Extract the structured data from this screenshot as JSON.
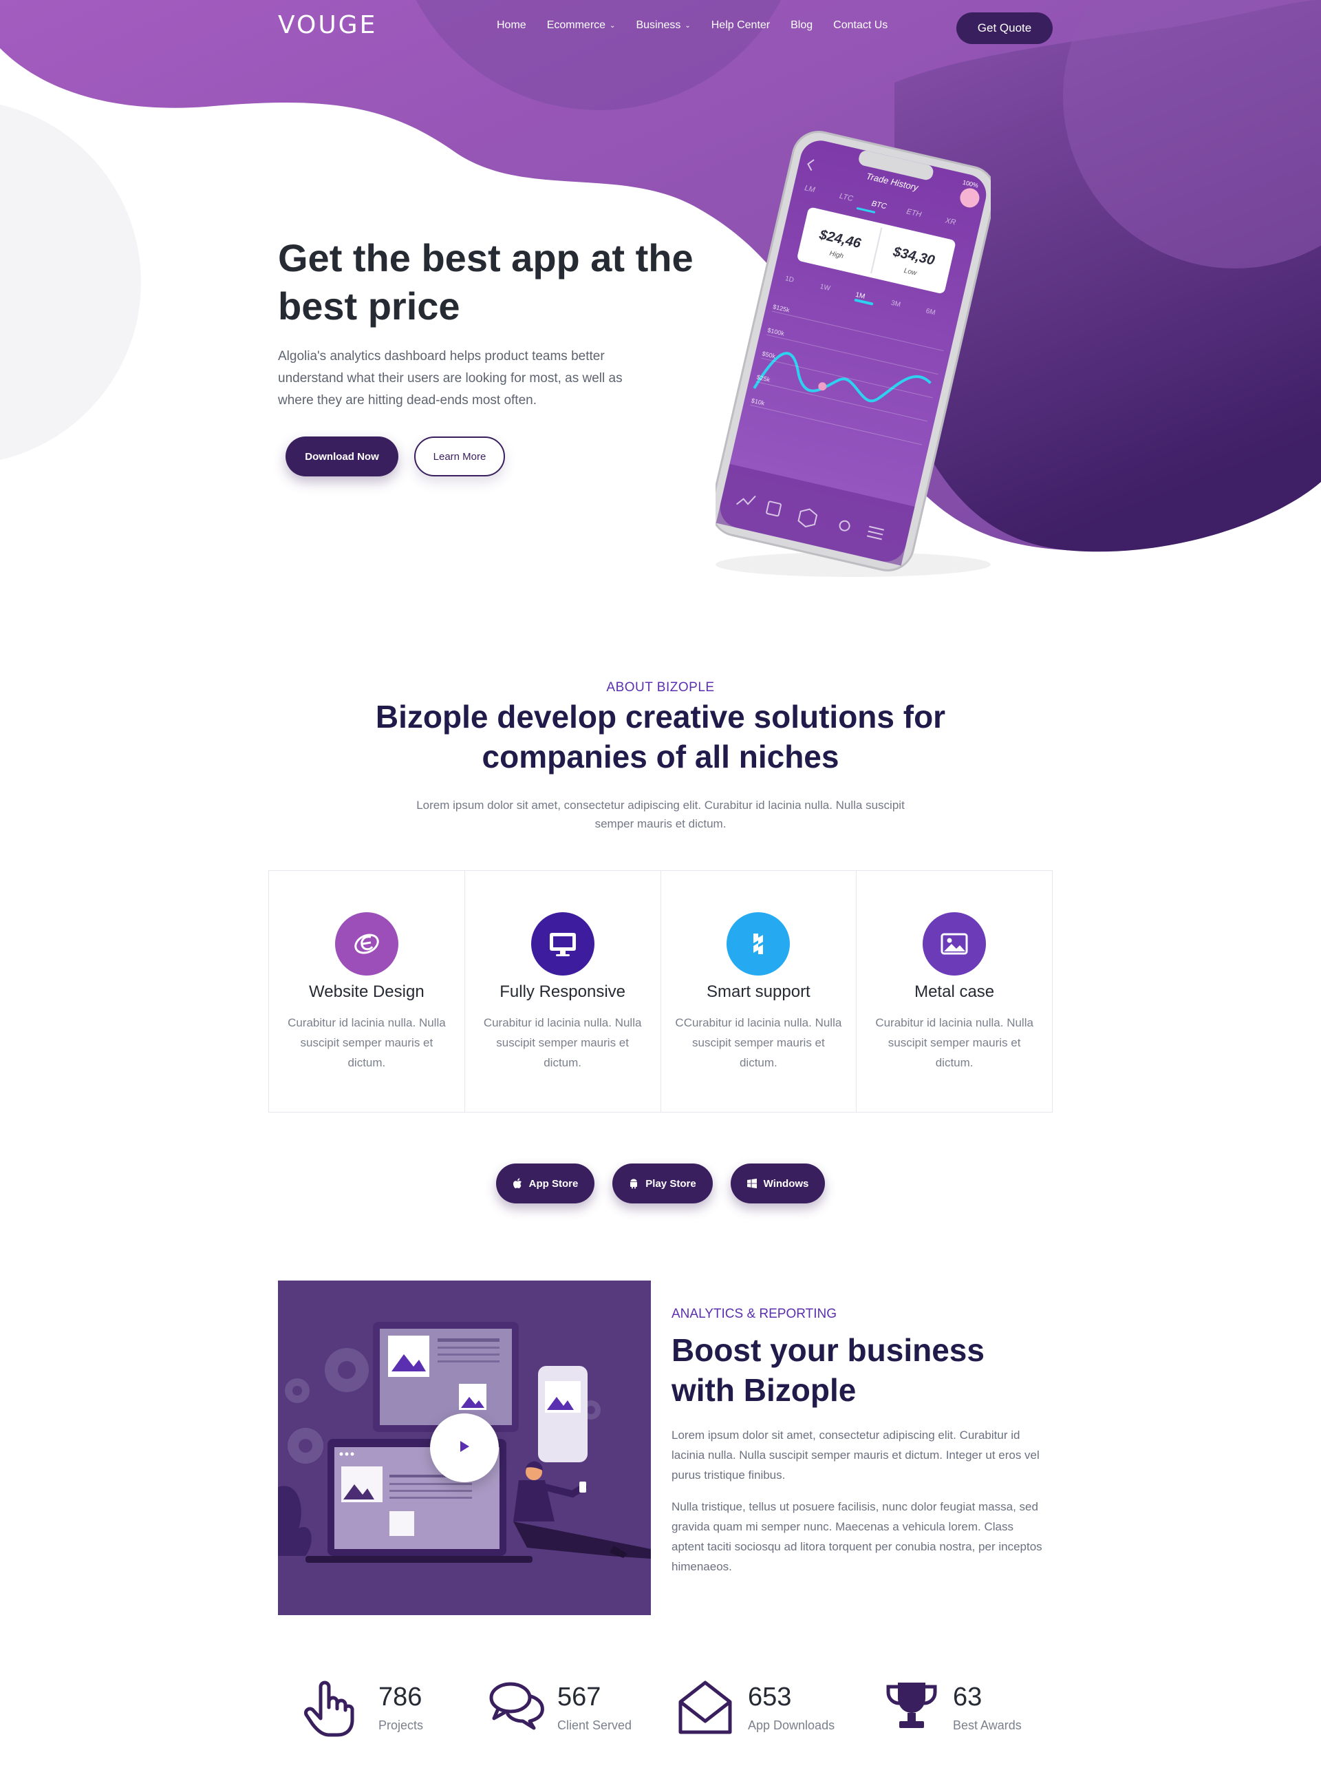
{
  "brand": {
    "logo": "VOUGE",
    "primary": "#3a1f5e",
    "accent": "#5a2fb0",
    "hero_gradient": [
      "#9b59b6",
      "#4a2470"
    ]
  },
  "nav": {
    "items": [
      {
        "label": "Home"
      },
      {
        "label": "Ecommerce",
        "dropdown": true
      },
      {
        "label": "Business",
        "dropdown": true
      },
      {
        "label": "Help Center"
      },
      {
        "label": "Blog"
      },
      {
        "label": "Contact Us"
      }
    ],
    "cta": "Get Quote"
  },
  "hero": {
    "title": "Get the best app at the best price",
    "description": "Algolia's analytics dashboard helps product teams better understand what their users are looking for most, as well as where they are hitting dead-ends most often.",
    "primary_button": "Download Now",
    "secondary_button": "Learn More",
    "phone": {
      "header": "Trade History",
      "status_battery": "100%",
      "coin_tabs": [
        "LM",
        "LTC",
        "BTC",
        "ETH",
        "XR"
      ],
      "active_coin": "BTC",
      "high_value": "$24,46",
      "high_label": "High",
      "low_value": "$34,30",
      "low_label": "Low",
      "ranges": [
        "1D",
        "1W",
        "1M",
        "3M",
        "6M"
      ],
      "active_range": "1M",
      "y_ticks": [
        "$125k",
        "$100k",
        "$50k",
        "$25k",
        "$10k"
      ]
    }
  },
  "about": {
    "eyebrow": "ABOUT BIZOPLE",
    "title": "Bizople develop creative solutions for companies of all niches",
    "description": "Lorem ipsum dolor sit amet, consectetur adipiscing elit. Curabitur id lacinia nulla. Nulla suscipit semper mauris et dictum.",
    "features": [
      {
        "icon": "design-icon",
        "color": "#9c4fb8",
        "title": "Website Design",
        "desc": "Curabitur id lacinia nulla. Nulla suscipit semper mauris et dictum."
      },
      {
        "icon": "monitor-icon",
        "color": "#3d1d9e",
        "title": "Fully Responsive",
        "desc": "Curabitur id lacinia nulla. Nulla suscipit semper mauris et dictum."
      },
      {
        "icon": "support-icon",
        "color": "#25aaf2",
        "title": "Smart support",
        "desc": "CCurabitur id lacinia nulla. Nulla suscipit semper mauris et dictum."
      },
      {
        "icon": "image-icon",
        "color": "#6b3bb8",
        "title": "Metal case",
        "desc": "Curabitur id lacinia nulla. Nulla suscipit semper mauris et dictum."
      }
    ],
    "stores": [
      {
        "icon": "apple-icon",
        "label": "App Store"
      },
      {
        "icon": "android-icon",
        "label": "Play Store"
      },
      {
        "icon": "windows-icon",
        "label": "Windows"
      }
    ]
  },
  "analytics": {
    "eyebrow": "ANALYTICS & REPORTING",
    "title": "Boost your business with Bizople",
    "paragraph_1": "Lorem ipsum dolor sit amet, consectetur adipiscing elit. Curabitur id lacinia nulla. Nulla suscipit semper mauris et dictum. Integer ut eros vel purus tristique finibus.",
    "paragraph_2": "Nulla tristique, tellus ut posuere facilisis, nunc dolor feugiat massa, sed gravida quam mi semper nunc. Maecenas a vehicula lorem. Class aptent taciti sociosqu ad litora torquent per conubia nostra, per inceptos himenaeos."
  },
  "stats": [
    {
      "icon": "pointer-hand-icon",
      "value": "786",
      "label": "Projects"
    },
    {
      "icon": "chat-bubbles-icon",
      "value": "567",
      "label": "Client Served"
    },
    {
      "icon": "open-envelope-icon",
      "value": "653",
      "label": "App Downloads"
    },
    {
      "icon": "trophy-icon",
      "value": "63",
      "label": "Best Awards"
    }
  ]
}
